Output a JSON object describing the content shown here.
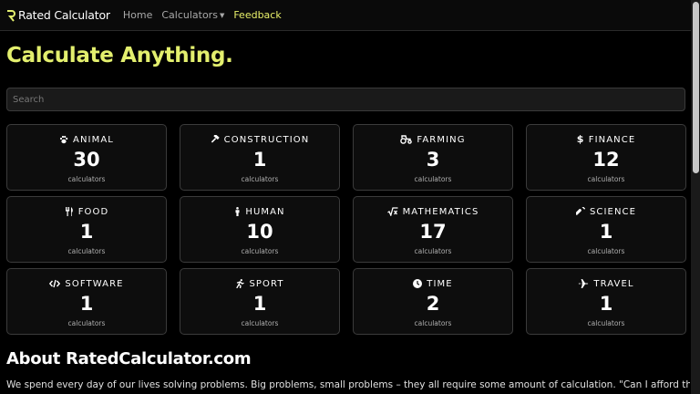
{
  "nav": {
    "brand": "Rated Calculator",
    "links": [
      "Home",
      "Calculators",
      "Feedback"
    ]
  },
  "hero": {
    "title": "Calculate Anything."
  },
  "search": {
    "placeholder": "Search"
  },
  "categories": [
    {
      "name": "ANIMAL",
      "count": "30",
      "sub": "calculators",
      "icon": "paw-icon"
    },
    {
      "name": "CONSTRUCTION",
      "count": "1",
      "sub": "calculators",
      "icon": "hammer-icon"
    },
    {
      "name": "FARMING",
      "count": "3",
      "sub": "calculators",
      "icon": "tractor-icon"
    },
    {
      "name": "FINANCE",
      "count": "12",
      "sub": "calculators",
      "icon": "dollar-icon"
    },
    {
      "name": "FOOD",
      "count": "1",
      "sub": "calculators",
      "icon": "utensils-icon"
    },
    {
      "name": "HUMAN",
      "count": "10",
      "sub": "calculators",
      "icon": "person-icon"
    },
    {
      "name": "MATHEMATICS",
      "count": "17",
      "sub": "calculators",
      "icon": "square-root-icon"
    },
    {
      "name": "SCIENCE",
      "count": "1",
      "sub": "calculators",
      "icon": "flask-icon"
    },
    {
      "name": "SOFTWARE",
      "count": "1",
      "sub": "calculators",
      "icon": "code-icon"
    },
    {
      "name": "SPORT",
      "count": "1",
      "sub": "calculators",
      "icon": "runner-icon"
    },
    {
      "name": "TIME",
      "count": "2",
      "sub": "calculators",
      "icon": "clock-icon"
    },
    {
      "name": "TRAVEL",
      "count": "1",
      "sub": "calculators",
      "icon": "plane-icon"
    }
  ],
  "about": {
    "title": "About RatedCalculator.com",
    "text": "We spend every day of our lives solving problems. Big problems, small problems – they all require some amount of calculation. \"Can I afford this mortgage?\" \"Is my"
  },
  "colors": {
    "accent": "#e3ef6e",
    "background": "#000000",
    "card_border": "#3b3b3b"
  }
}
